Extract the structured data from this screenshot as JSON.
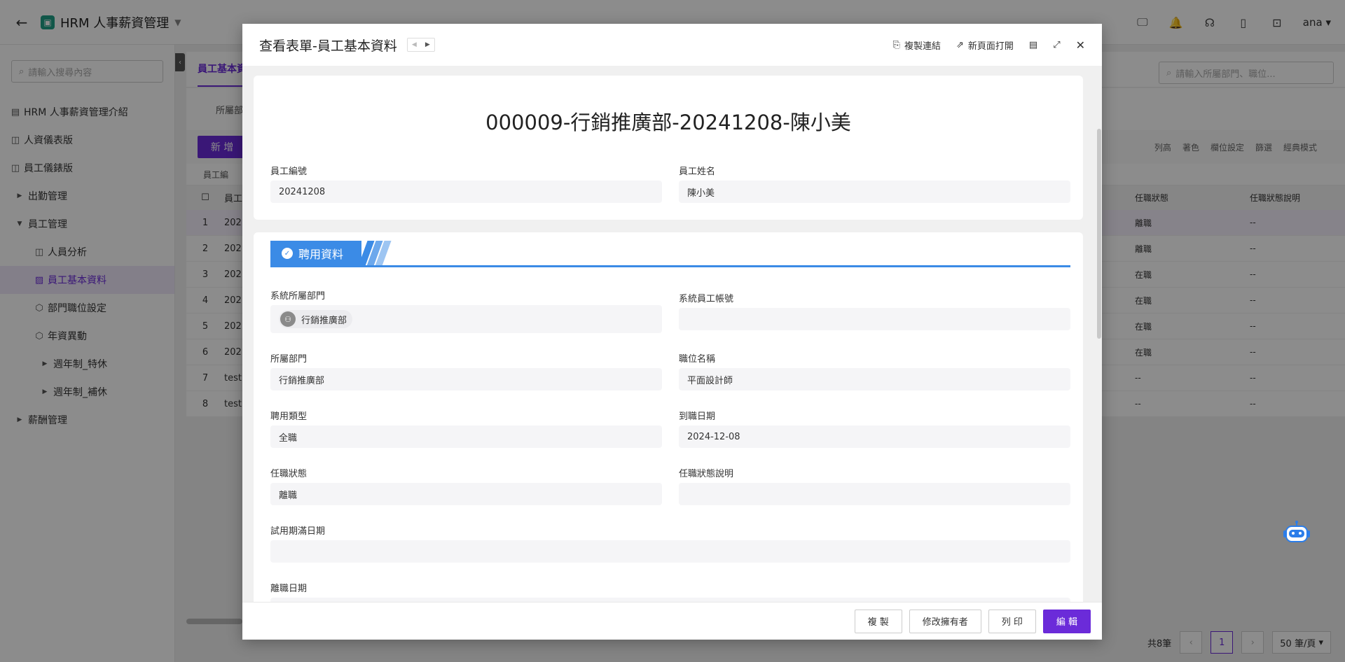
{
  "app": {
    "title": "HRM 人事薪資管理",
    "user": "ana"
  },
  "sidebar": {
    "search_placeholder": "請輸入搜尋內容",
    "items": [
      {
        "label": "HRM 人事薪資管理介紹",
        "icon": "table-icon"
      },
      {
        "label": "人資儀表版",
        "icon": "dashboard-icon"
      },
      {
        "label": "員工儀錶版",
        "icon": "dashboard-icon"
      },
      {
        "label": "出勤管理",
        "icon": "caret-right-icon"
      },
      {
        "label": "員工管理",
        "icon": "caret-down-icon"
      },
      {
        "label": "人員分析",
        "icon": "dashboard-icon"
      },
      {
        "label": "員工基本資料",
        "icon": "form-icon"
      },
      {
        "label": "部門職位設定",
        "icon": "cube-icon"
      },
      {
        "label": "年資異動",
        "icon": "cube-icon"
      },
      {
        "label": "週年制_特休",
        "icon": "caret-right-icon"
      },
      {
        "label": "週年制_補休",
        "icon": "caret-right-icon"
      },
      {
        "label": "薪酬管理",
        "icon": "caret-right-icon"
      }
    ]
  },
  "main": {
    "tab": "員工基本資",
    "right_search_placeholder": "請輸入所屬部門、職位...",
    "filter_label": "所屬部",
    "add_label": "新 增",
    "toolbar": [
      "列高",
      "著色",
      "欄位設定",
      "篩選",
      "經典模式"
    ],
    "group_label": "員工編",
    "headers": {
      "no": "員工",
      "status": "任職狀態",
      "note": "任職狀態說明"
    },
    "rows": [
      {
        "idx": "1",
        "no": "202",
        "status": "離職",
        "note": "--"
      },
      {
        "idx": "2",
        "no": "202",
        "status": "離職",
        "note": "--"
      },
      {
        "idx": "3",
        "no": "202",
        "status": "在職",
        "note": "--"
      },
      {
        "idx": "4",
        "no": "202",
        "status": "在職",
        "note": "--"
      },
      {
        "idx": "5",
        "no": "202",
        "status": "在職",
        "note": "--"
      },
      {
        "idx": "6",
        "no": "202",
        "status": "在職",
        "note": "--"
      },
      {
        "idx": "7",
        "no": "test",
        "status": "--",
        "note": "--"
      },
      {
        "idx": "8",
        "no": "test",
        "status": "--",
        "note": "--"
      }
    ],
    "pager": {
      "total": "共8筆",
      "page": "1",
      "size": "50 筆/頁"
    }
  },
  "modal": {
    "title": "查看表單-員工基本資料",
    "actions": {
      "copy_link": "複製連結",
      "open_new": "新頁面打開"
    },
    "record_title": "000009-行銷推廣部-20241208-陳小美",
    "emp_no_label": "員工編號",
    "emp_no": "20241208",
    "emp_name_label": "員工姓名",
    "emp_name": "陳小美",
    "section": "聘用資料",
    "sys_dept_label": "系統所屬部門",
    "sys_dept": "行銷推廣部",
    "sys_account_label": "系統員工帳號",
    "sys_account": "",
    "dept_label": "所屬部門",
    "dept": "行銷推廣部",
    "position_label": "職位名稱",
    "position": "平面設計師",
    "hire_type_label": "聘用類型",
    "hire_type": "全職",
    "start_date_label": "到職日期",
    "start_date": "2024-12-08",
    "status_label": "任職狀態",
    "status": "離職",
    "status_note_label": "任職狀態說明",
    "status_note": "",
    "probation_label": "試用期滿日期",
    "probation": "",
    "leave_label": "離職日期",
    "footer": {
      "copy": "複 製",
      "owner": "修改擁有者",
      "print": "列 印",
      "edit": "編 輯"
    }
  }
}
